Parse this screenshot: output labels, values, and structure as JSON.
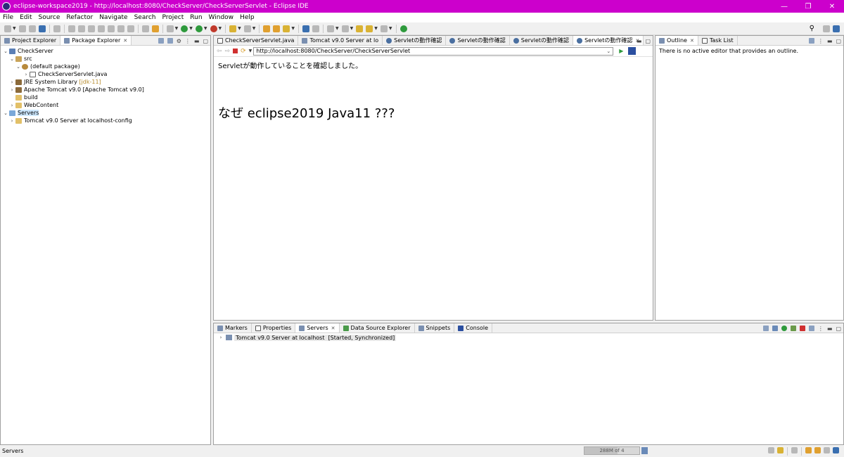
{
  "window": {
    "title": "eclipse-workspace2019 - http://localhost:8080/CheckServer/CheckServerServlet - Eclipse IDE"
  },
  "menu": [
    "File",
    "Edit",
    "Source",
    "Refactor",
    "Navigate",
    "Search",
    "Project",
    "Run",
    "Window",
    "Help"
  ],
  "explorer": {
    "tabs": [
      {
        "label": "Project Explorer"
      },
      {
        "label": "Package Explorer"
      }
    ],
    "tree": {
      "project": "CheckServer",
      "src": "src",
      "default_package": "(default package)",
      "java_file": "CheckServerServlet.java",
      "jre_label": "JRE System Library",
      "jre_suffix": "[jdk-11]",
      "tomcat_lib": "Apache Tomcat v9.0 [Apache Tomcat v9.0]",
      "build": "build",
      "webcontent": "WebContent",
      "servers": "Servers",
      "server_config": "Tomcat v9.0 Server at localhost-config"
    }
  },
  "editor": {
    "tabs": [
      {
        "label": "CheckServerServlet.java"
      },
      {
        "label": "Tomcat v9.0 Server at lo"
      },
      {
        "label": "Servletの動作確認"
      },
      {
        "label": "Servletの動作確認"
      },
      {
        "label": "Servletの動作確認"
      },
      {
        "label": "Servletの動作確認"
      }
    ],
    "url": "http://localhost:8080/CheckServer/CheckServerServlet",
    "content_line1": "Servletが動作していることを確認しました。",
    "content_big": "なぜ eclipse2019 Java11 ???"
  },
  "outline": {
    "tabs": [
      {
        "label": "Outline"
      },
      {
        "label": "Task List"
      }
    ],
    "message": "There is no active editor that provides an outline."
  },
  "bottom": {
    "tabs": [
      {
        "label": "Markers"
      },
      {
        "label": "Properties"
      },
      {
        "label": "Servers"
      },
      {
        "label": "Data Source Explorer"
      },
      {
        "label": "Snippets"
      },
      {
        "label": "Console"
      }
    ],
    "server_name": "Tomcat v9.0 Server at localhost",
    "server_status": "[Started, Synchronized]"
  },
  "status": {
    "text": "Servers",
    "heap": "288M of 4",
    "heap_fraction": 0.6
  }
}
